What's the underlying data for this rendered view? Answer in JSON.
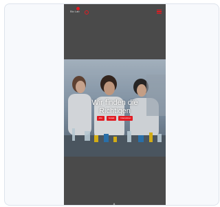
{
  "header": {
    "logo_text": "Bio Lab"
  },
  "hero": {
    "title_line1": "Wir finden die",
    "title_line2": "Richtigen",
    "buttons": [
      "Jobs",
      "Kontakt",
      "Unternehmen"
    ]
  },
  "colors": {
    "accent": "#e11b22",
    "phone_background": "#4a4a4a",
    "card_background": "#f7f9fc"
  },
  "icons": {
    "menu": "hamburger-menu-icon",
    "scroll": "arrow-down-icon"
  }
}
